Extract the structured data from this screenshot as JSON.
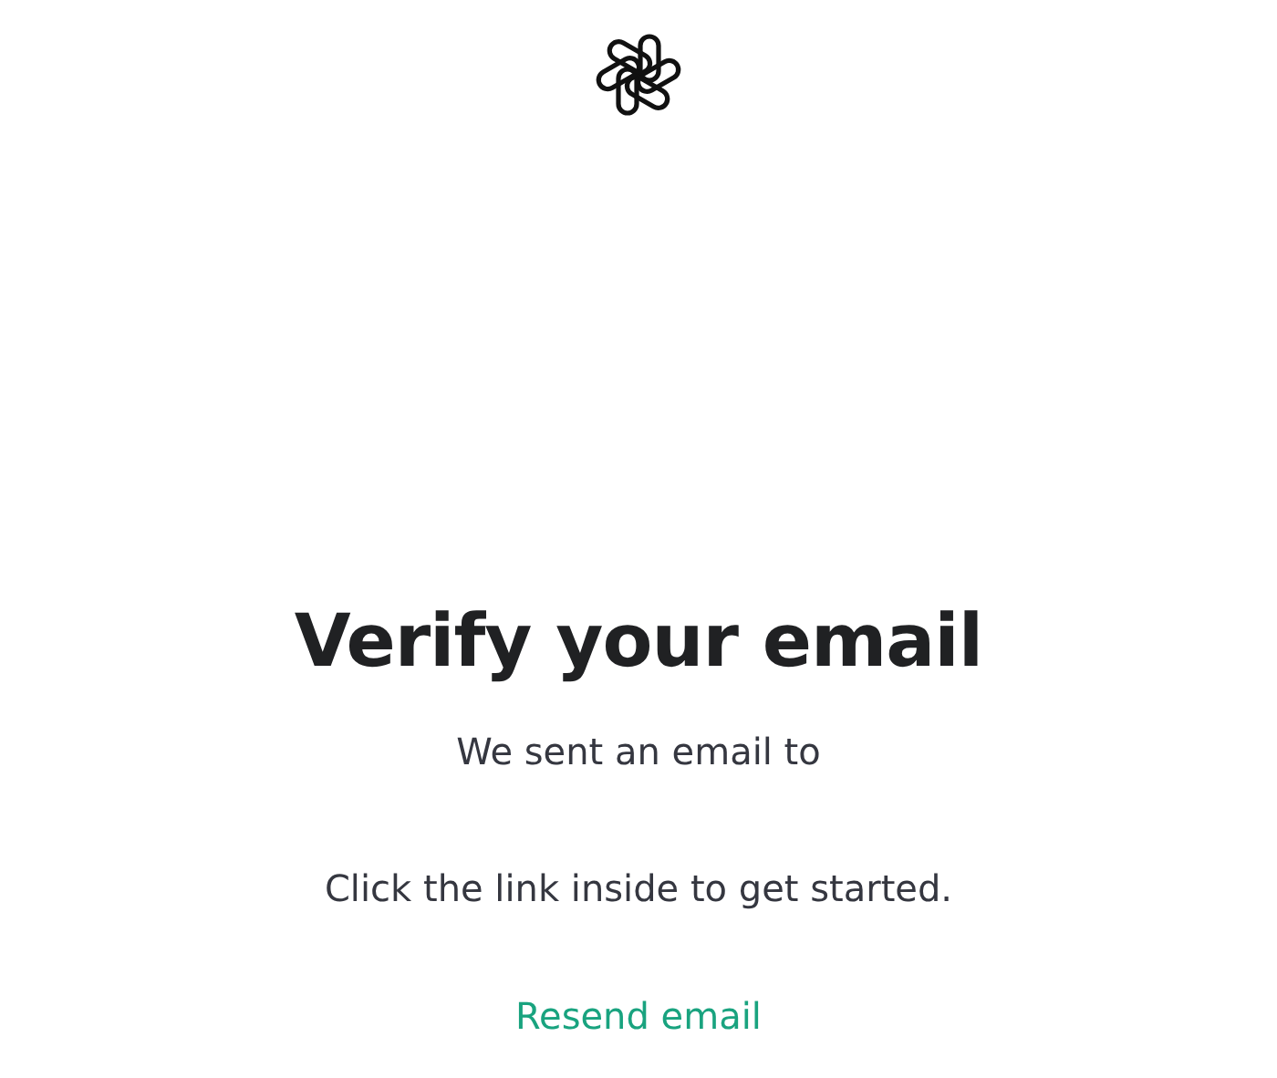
{
  "heading": "Verify your email",
  "sent_line": "We sent an email to",
  "instruction": "Click the link inside to get started.",
  "resend_link": "Resend email"
}
